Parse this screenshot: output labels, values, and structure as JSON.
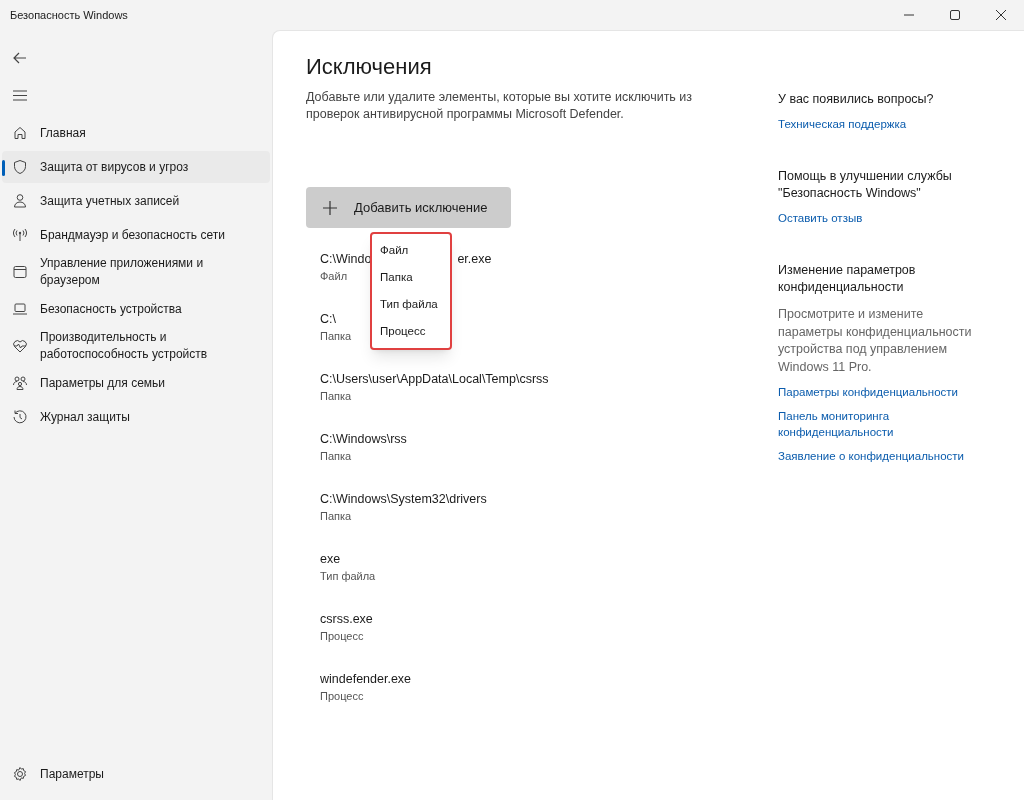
{
  "window": {
    "title": "Безопасность Windows"
  },
  "sidebar": {
    "items": [
      {
        "label": "Главная",
        "selected": false
      },
      {
        "label": "Защита от вирусов и угроз",
        "selected": true
      },
      {
        "label": "Защита учетных записей",
        "selected": false
      },
      {
        "label": "Брандмауэр и безопасность сети",
        "selected": false
      },
      {
        "label": "Управление приложениями и браузером",
        "selected": false
      },
      {
        "label": "Безопасность устройства",
        "selected": false
      },
      {
        "label": "Производительность и работоспособность устройств",
        "selected": false
      },
      {
        "label": "Параметры для семьи",
        "selected": false
      },
      {
        "label": "Журнал защиты",
        "selected": false
      }
    ],
    "settings": "Параметры"
  },
  "page": {
    "title": "Исключения",
    "description": "Добавьте или удалите элементы, которые вы хотите исключить из проверок антивирусной программы Microsoft Defender.",
    "add_button": "Добавить исключение",
    "menu": [
      "Файл",
      "Папка",
      "Тип файла",
      "Процесс"
    ],
    "exclusions": [
      {
        "path": "C:\\Windo",
        "path_end": "er.exe",
        "type": "Файл"
      },
      {
        "path": "C:\\",
        "type": "Папка"
      },
      {
        "path": "C:\\Users\\user\\AppData\\Local\\Temp\\csrss",
        "type": "Папка"
      },
      {
        "path": "C:\\Windows\\rss",
        "type": "Папка"
      },
      {
        "path": "C:\\Windows\\System32\\drivers",
        "type": "Папка"
      },
      {
        "path": "exe",
        "type": "Тип файла"
      },
      {
        "path": "csrss.exe",
        "type": "Процесс"
      },
      {
        "path": "windefender.exe",
        "type": "Процесс"
      }
    ]
  },
  "aside": [
    {
      "heading": "У вас появились вопросы?",
      "links": [
        "Техническая поддержка"
      ]
    },
    {
      "heading": "Помощь в улучшении службы \"Безопасность Windows\"",
      "links": [
        "Оставить отзыв"
      ]
    },
    {
      "heading": "Изменение параметров конфиденциальности",
      "text": "Просмотрите и измените параметры конфиденциальности устройства под управлением Windows 11 Pro.",
      "links": [
        "Параметры конфиденциальности",
        "Панель мониторинга конфиденциальности",
        "Заявление о конфиденциальности"
      ]
    }
  ]
}
